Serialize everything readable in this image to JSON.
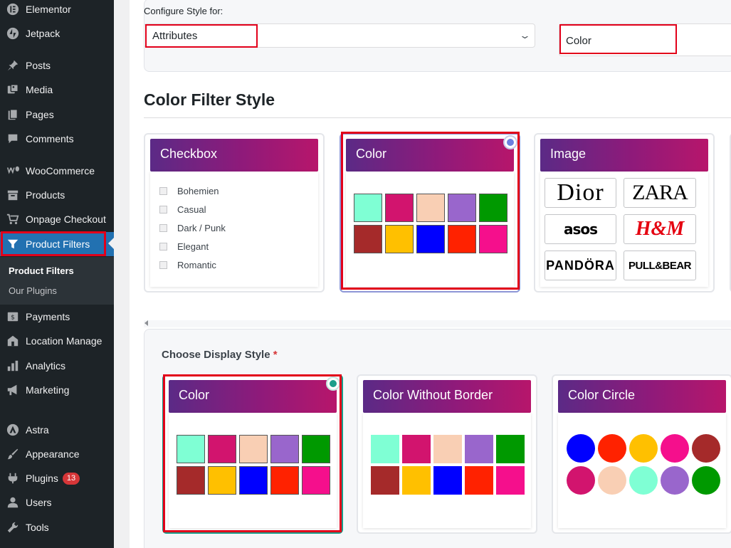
{
  "sidebar": {
    "items": [
      {
        "label": "Elementor",
        "icon": "elementor-icon"
      },
      {
        "label": "Jetpack",
        "icon": "jetpack-icon"
      },
      {
        "label": "Posts",
        "icon": "pin-icon"
      },
      {
        "label": "Media",
        "icon": "media-icon"
      },
      {
        "label": "Pages",
        "icon": "pages-icon"
      },
      {
        "label": "Comments",
        "icon": "comment-icon"
      },
      {
        "label": "WooCommerce",
        "icon": "woocommerce-icon"
      },
      {
        "label": "Products",
        "icon": "archive-icon"
      },
      {
        "label": "Onpage Checkout",
        "icon": "cart-icon"
      },
      {
        "label": "Product Filters",
        "icon": "filter-icon"
      },
      {
        "label": "Payments",
        "icon": "payments-icon"
      },
      {
        "label": "Location Manage",
        "icon": "store-icon"
      },
      {
        "label": "Analytics",
        "icon": "bar-chart-icon"
      },
      {
        "label": "Marketing",
        "icon": "megaphone-icon"
      },
      {
        "label": "Astra",
        "icon": "astra-icon"
      },
      {
        "label": "Appearance",
        "icon": "brush-icon"
      },
      {
        "label": "Plugins",
        "icon": "plugin-icon",
        "badge": "13"
      },
      {
        "label": "Users",
        "icon": "user-icon"
      },
      {
        "label": "Tools",
        "icon": "wrench-icon"
      }
    ],
    "submenu": [
      "Product Filters",
      "Our Plugins"
    ]
  },
  "config": {
    "label": "Configure Style for:",
    "attribute_value": "Attributes",
    "type_value": "Color"
  },
  "filter_style": {
    "title": "Color Filter Style",
    "cards": {
      "checkbox": {
        "title": "Checkbox",
        "options": [
          "Bohemien",
          "Casual",
          "Dark / Punk",
          "Elegant",
          "Romantic"
        ]
      },
      "color": {
        "title": "Color"
      },
      "image": {
        "title": "Image",
        "brands": [
          "Dior",
          "ZARA",
          "asos",
          "H&M",
          "PANDÖRA",
          "PULL&BEAR"
        ]
      }
    }
  },
  "display_style": {
    "label": "Choose Display Style",
    "required_mark": "*",
    "cards": {
      "color": {
        "title": "Color"
      },
      "color_no_border": {
        "title": "Color Without Border"
      },
      "color_circle": {
        "title": "Color Circle"
      }
    }
  },
  "swatch_colors": [
    "#7fffd4",
    "#d2146e",
    "#f9cfb4",
    "#9966cc",
    "#009900",
    "#a52a2a",
    "#ffc000",
    "#0000ff",
    "#ff2200",
    "#f50f8c"
  ],
  "circle_colors": [
    "#0000ff",
    "#ff2200",
    "#ffc000",
    "#f50f8c",
    "#a52a2a",
    "#d2146e",
    "#f9cfb4",
    "#7fffd4",
    "#9966cc",
    "#009900"
  ],
  "colors": {
    "highlight": "#e2001a",
    "selected_radio_blue": "#6b7fe0",
    "selected_radio_teal": "#1a9e8a",
    "admin_blue": "#2271b1"
  }
}
